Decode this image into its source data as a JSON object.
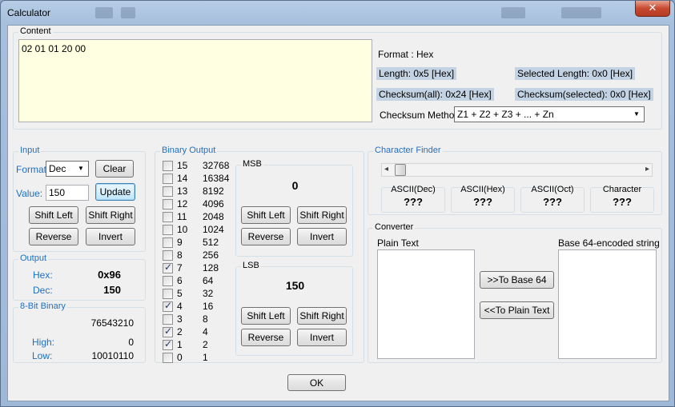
{
  "window": {
    "title": "Calculator",
    "close_glyph": "✕"
  },
  "content": {
    "label": "Content",
    "text": "02 01 01 20 00",
    "format": "Format : Hex",
    "length": "Length:  0x5 [Hex]",
    "selected_length": "Selected Length:  0x0 [Hex]",
    "checksum_all": "Checksum(all):  0x24 [Hex]",
    "checksum_selected": "Checksum(selected):  0x0 [Hex]",
    "checksum_method_label": "Checksum Method:",
    "checksum_method_value": "Z1 + Z2 + Z3 + ... + Zn"
  },
  "input": {
    "title": "Input",
    "format_label": "Format:",
    "format_value": "Dec",
    "clear": "Clear",
    "value_label": "Value:",
    "value": "150",
    "update": "Update",
    "shift_left": "Shift Left",
    "shift_right": "Shift Right",
    "reverse": "Reverse",
    "invert": "Invert"
  },
  "output": {
    "title": "Output",
    "hex_label": "Hex:",
    "hex_value": "0x96",
    "dec_label": "Dec:",
    "dec_value": "150"
  },
  "binary8": {
    "title": "8-Bit Binary",
    "positions": "76543210",
    "high_label": "High:",
    "high_value": "0",
    "low_label": "Low:",
    "low_value": "10010110"
  },
  "binary_output": {
    "title": "Binary Output",
    "bits": [
      {
        "bit": "15",
        "weight": "32768",
        "checked": false
      },
      {
        "bit": "14",
        "weight": "16384",
        "checked": false
      },
      {
        "bit": "13",
        "weight": "8192",
        "checked": false
      },
      {
        "bit": "12",
        "weight": "4096",
        "checked": false
      },
      {
        "bit": "11",
        "weight": "2048",
        "checked": false
      },
      {
        "bit": "10",
        "weight": "1024",
        "checked": false
      },
      {
        "bit": "9",
        "weight": "512",
        "checked": false
      },
      {
        "bit": "8",
        "weight": "256",
        "checked": false
      },
      {
        "bit": "7",
        "weight": "128",
        "checked": true
      },
      {
        "bit": "6",
        "weight": "64",
        "checked": false
      },
      {
        "bit": "5",
        "weight": "32",
        "checked": false
      },
      {
        "bit": "4",
        "weight": "16",
        "checked": true
      },
      {
        "bit": "3",
        "weight": "8",
        "checked": false
      },
      {
        "bit": "2",
        "weight": "4",
        "checked": true
      },
      {
        "bit": "1",
        "weight": "2",
        "checked": true
      },
      {
        "bit": "0",
        "weight": "1",
        "checked": false
      }
    ],
    "msb": {
      "title": "MSB",
      "value": "0",
      "shift_left": "Shift Left",
      "shift_right": "Shift Right",
      "reverse": "Reverse",
      "invert": "Invert"
    },
    "lsb": {
      "title": "LSB",
      "value": "150",
      "shift_left": "Shift Left",
      "shift_right": "Shift Right",
      "reverse": "Reverse",
      "invert": "Invert"
    }
  },
  "character_finder": {
    "title": "Character Finder",
    "slider_left": "◂",
    "slider_right": "▸",
    "boxes": [
      {
        "label": "ASCII(Dec)",
        "value": "???"
      },
      {
        "label": "ASCII(Hex)",
        "value": "???"
      },
      {
        "label": "ASCII(Oct)",
        "value": "???"
      },
      {
        "label": "Character",
        "value": "???"
      }
    ]
  },
  "converter": {
    "title": "Converter",
    "plain_label": "Plain Text",
    "base64_label": "Base 64-encoded string",
    "to_base64": ">>To Base 64",
    "to_plain": "<<To Plain Text"
  },
  "ok": "OK"
}
